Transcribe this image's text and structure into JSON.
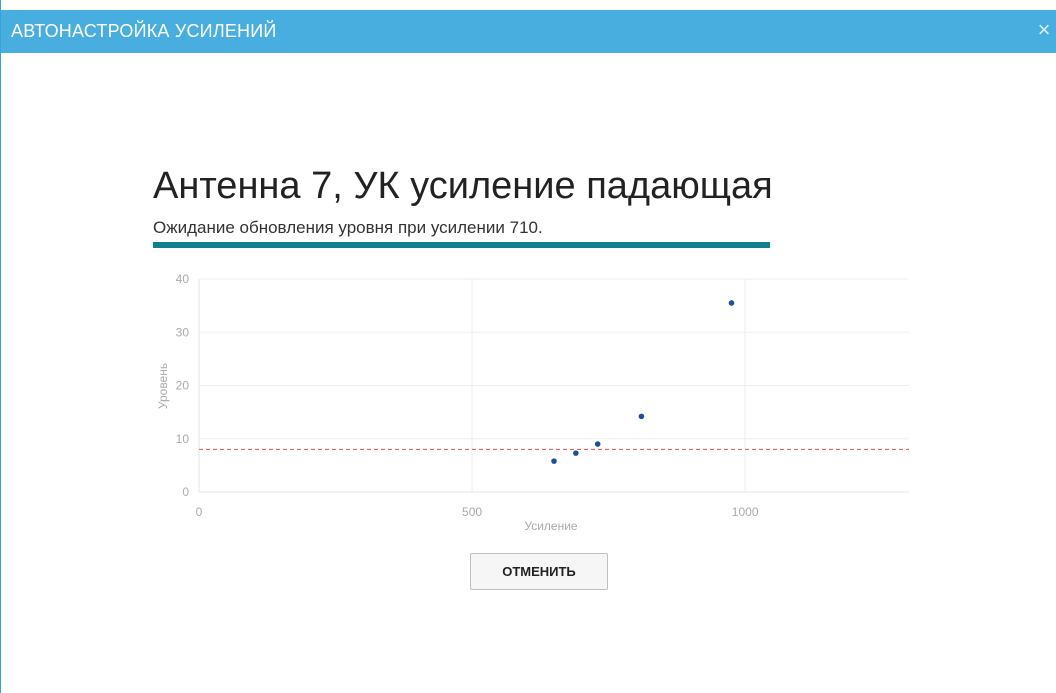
{
  "window": {
    "title": "АВТОНАСТРОЙКА УСИЛЕНИЙ",
    "close_glyph": "×"
  },
  "header": {
    "title": "Антенна 7, УК усиление падающая",
    "status": "Ожидание обновления уровня при усилении 710.",
    "progress": 1.0,
    "progress_color": "#11808a"
  },
  "chart_data": {
    "type": "scatter",
    "title": "",
    "xlabel": "Усиление",
    "ylabel": "Уровень",
    "xlim": [
      0,
      1300
    ],
    "ylim": [
      0,
      40
    ],
    "x_ticks": [
      0,
      500,
      1000
    ],
    "y_ticks": [
      0,
      10,
      20,
      30,
      40
    ],
    "grid": true,
    "series": [
      {
        "color": "#1f4e9c",
        "points": [
          {
            "x": 650,
            "y": 5.8
          },
          {
            "x": 690,
            "y": 7.3
          },
          {
            "x": 730,
            "y": 9.0
          },
          {
            "x": 810,
            "y": 14.2
          },
          {
            "x": 975,
            "y": 35.5
          }
        ]
      }
    ],
    "threshold": {
      "y": 8,
      "color": "#e05252",
      "style": "dashed"
    }
  },
  "actions": {
    "cancel_label": "ОТМЕНИТЬ"
  }
}
